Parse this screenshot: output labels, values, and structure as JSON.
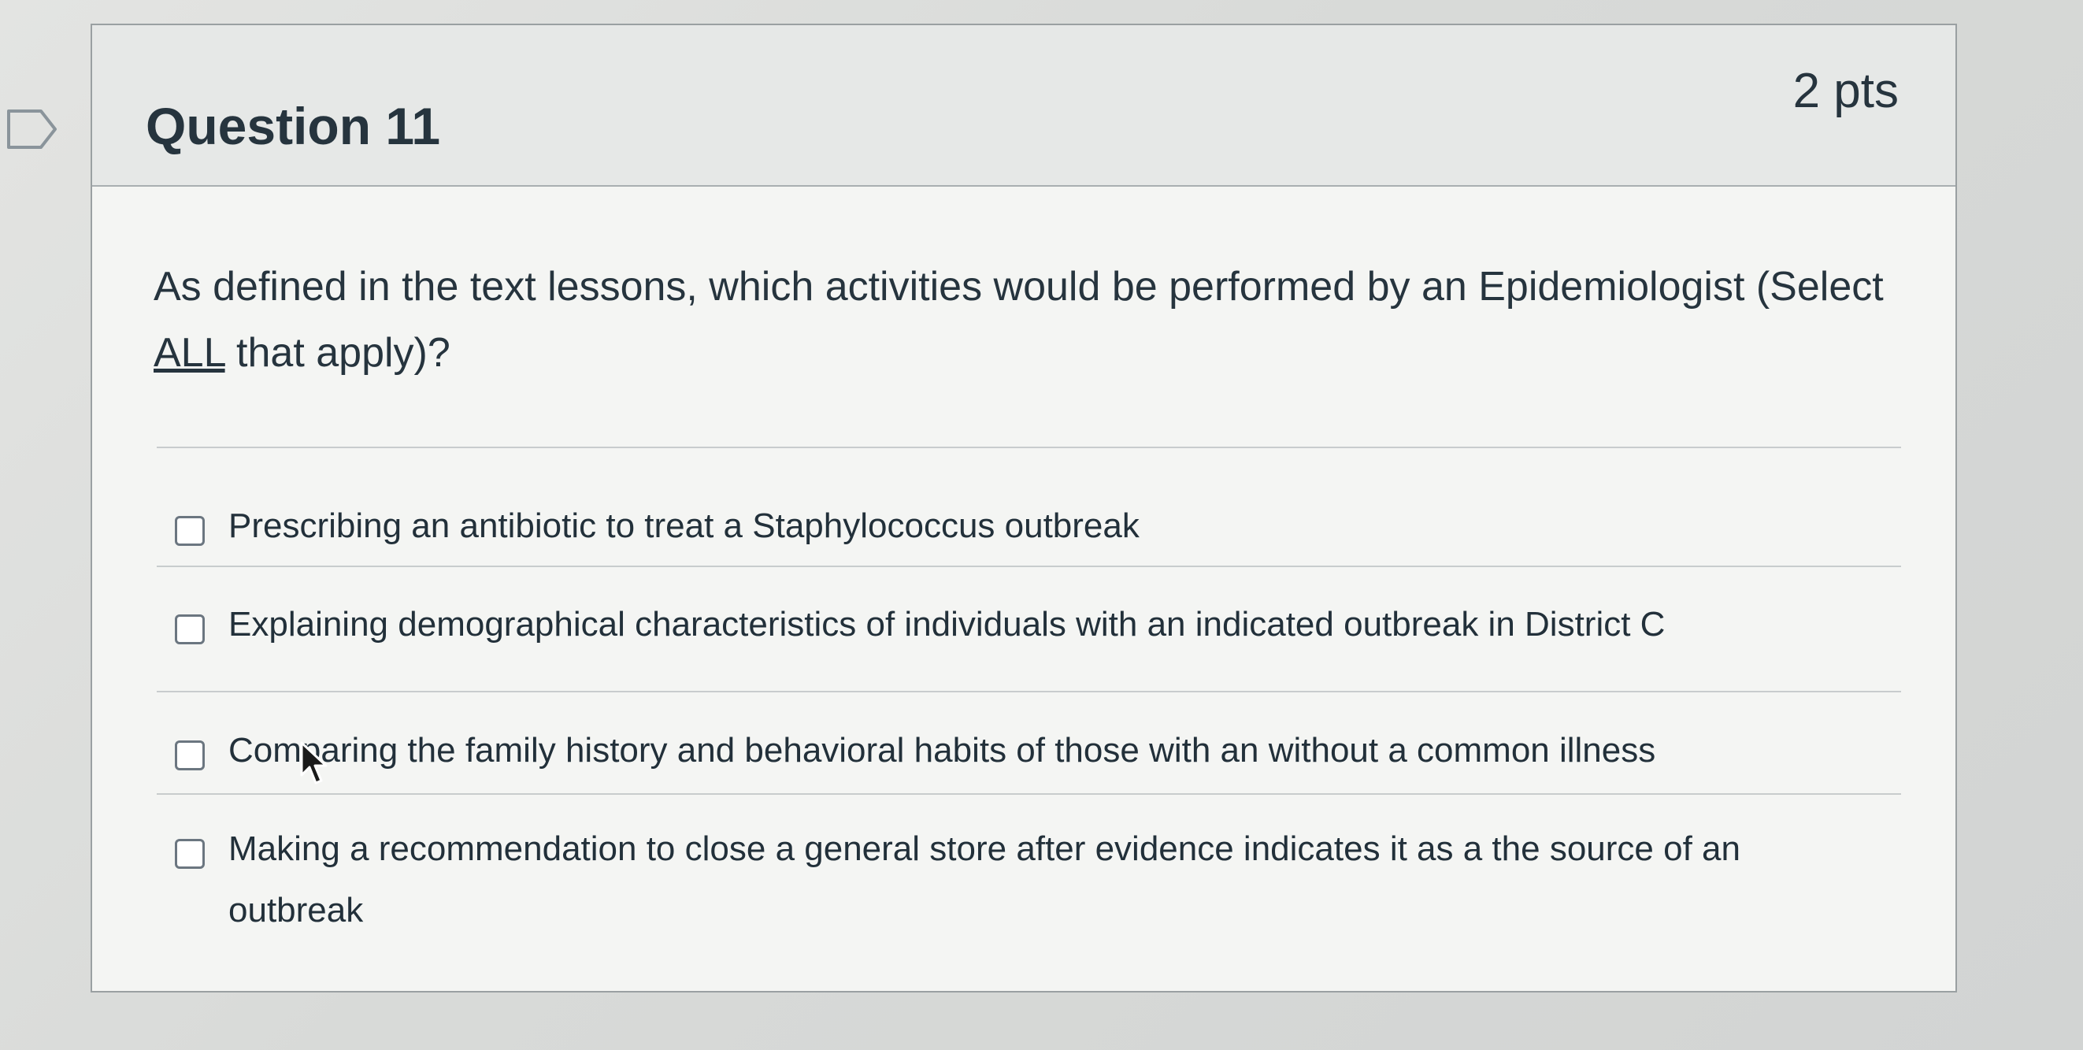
{
  "question": {
    "title": "Question 11",
    "points": "2 pts",
    "text_part1": "As defined in the text lessons, which activities would be performed by an Epidemiologist (Select ",
    "text_underlined": "ALL",
    "text_part2": " that apply)?"
  },
  "answers": [
    {
      "label": "Prescribing an antibiotic to treat a Staphylococcus outbreak"
    },
    {
      "label": "Explaining demographical characteristics of individuals with an indicated outbreak in District C"
    },
    {
      "label": "Comparing the family history and behavioral habits of those with an without a common illness"
    },
    {
      "label": "Making a recommendation to close a general store after evidence indicates it as a the source of an outbreak"
    }
  ],
  "icons": {
    "flag": "flag-icon",
    "cursor": "cursor-icon"
  },
  "colors": {
    "text": "#26343e",
    "header_bg": "#e6e8e7",
    "border": "#9aa0a2"
  }
}
